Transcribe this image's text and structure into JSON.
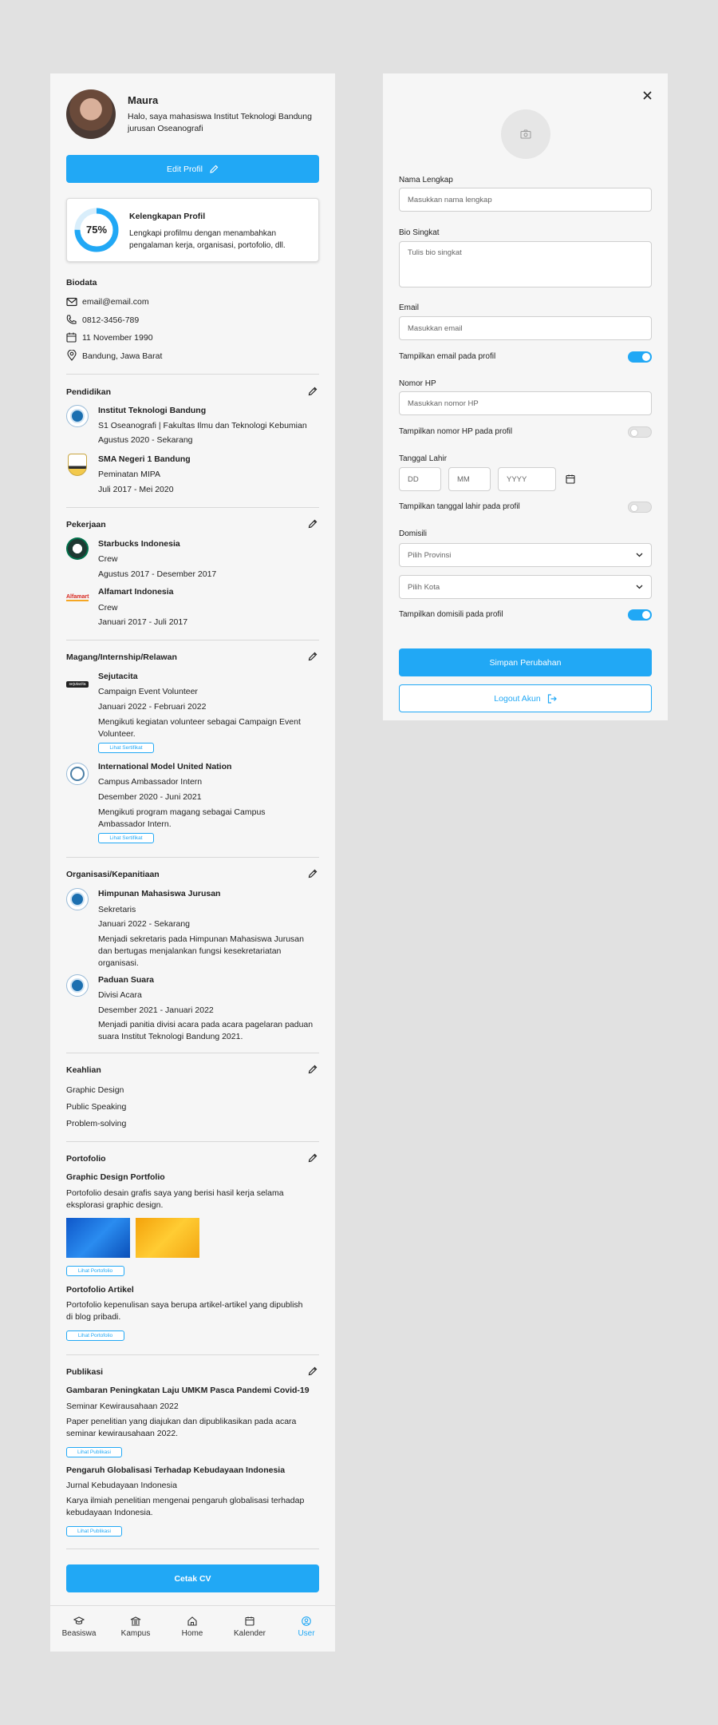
{
  "profile": {
    "name": "Maura",
    "bio": "Halo, saya mahasiswa Institut Teknologi Bandung jurusan Oseanografi",
    "edit_label": "Edit Profil"
  },
  "completeness": {
    "percent_label": "75%",
    "percent": 75,
    "title": "Kelengkapan Profil",
    "desc": "Lengkapi profilmu dengan menambahkan pengalaman kerja, organisasi, portofolio, dll."
  },
  "biodata": {
    "title": "Biodata",
    "email": "email@email.com",
    "phone": "0812-3456-789",
    "birth": "11 November 1990",
    "location": "Bandung, Jawa Barat"
  },
  "pendidikan": {
    "title": "Pendidikan",
    "items": [
      {
        "name": "Institut Teknologi Bandung",
        "detail": "S1 Oseanografi | Fakultas Ilmu dan Teknologi Kebumian",
        "period": "Agustus 2020 - Sekarang"
      },
      {
        "name": "SMA Negeri  1 Bandung",
        "detail": "Peminatan MIPA",
        "period": "Juli 2017 - Mei 2020"
      }
    ]
  },
  "pekerjaan": {
    "title": "Pekerjaan",
    "items": [
      {
        "name": "Starbucks Indonesia",
        "role": "Crew",
        "period": "Agustus 2017 - Desember 2017"
      },
      {
        "name": "Alfamart Indonesia",
        "logo": "Alfamart",
        "role": "Crew",
        "period": "Januari 2017 - Juli 2017"
      }
    ]
  },
  "magang": {
    "title": "Magang/Internship/Relawan",
    "items": [
      {
        "name": "Sejutacita",
        "logo": "sejutacita",
        "role": "Campaign Event Volunteer",
        "period": "Januari 2022 - Februari 2022",
        "desc": "Mengikuti kegiatan volunteer sebagai Campaign Event Volunteer.",
        "button": "Lihat Sertifikat"
      },
      {
        "name": "International Model United Nation",
        "role": "Campus Ambassador Intern",
        "period": "Desember 2020 - Juni 2021",
        "desc": "Mengikuti program magang sebagai Campus Ambassador Intern.",
        "button": "Lihat Sertifikat"
      }
    ]
  },
  "organisasi": {
    "title": "Organisasi/Kepanitiaan",
    "items": [
      {
        "name": "Himpunan Mahasiswa Jurusan",
        "role": "Sekretaris",
        "period": "Januari 2022 - Sekarang",
        "desc": "Menjadi sekretaris pada Himpunan Mahasiswa Jurusan dan bertugas menjalankan fungsi kesekretariatan organisasi."
      },
      {
        "name": "Paduan Suara",
        "role": "Divisi Acara",
        "period": "Desember 2021 - Januari 2022",
        "desc": "Menjadi panitia divisi acara pada acara pagelaran paduan suara Institut Teknologi Bandung 2021."
      }
    ]
  },
  "keahlian": {
    "title": "Keahlian",
    "items": [
      "Graphic Design",
      "Public Speaking",
      "Problem-solving"
    ]
  },
  "portofolio": {
    "title": "Portofolio",
    "items": [
      {
        "name": "Graphic Design Portfolio",
        "desc": "Portofolio desain grafis saya yang berisi hasil kerja selama eksplorasi graphic design.",
        "button": "Lihat Portofolio"
      },
      {
        "name": "Portofolio Artikel",
        "desc": "Portofolio kepenulisan saya berupa artikel-artikel yang dipublish di blog pribadi.",
        "button": "Lihat Portofolio"
      }
    ]
  },
  "publikasi": {
    "title": "Publikasi",
    "items": [
      {
        "name": "Gambaran Peningkatan Laju UMKM Pasca Pandemi Covid-19",
        "venue": "Seminar Kewirausahaan 2022",
        "desc": "Paper penelitian yang diajukan dan dipublikasikan pada acara seminar kewirausahaan 2022.",
        "button": "Lihat Publikasi"
      },
      {
        "name": "Pengaruh Globalisasi Terhadap Kebudayaan Indonesia",
        "venue": "Jurnal Kebudayaan Indonesia",
        "desc": "Karya ilmiah penelitian mengenai pengaruh globalisasi terhadap kebudayaan Indonesia.",
        "button": "Lihat Publikasi"
      }
    ]
  },
  "cetak_label": "Cetak CV",
  "nav": {
    "items": [
      "Beasiswa",
      "Kampus",
      "Home",
      "Kalender",
      "User"
    ],
    "active": "User"
  },
  "form": {
    "nama_label": "Nama Lengkap",
    "nama_placeholder": "Masukkan nama lengkap",
    "bio_label": "Bio Singkat",
    "bio_placeholder": "Tulis bio singkat",
    "email_label": "Email",
    "email_placeholder": "Masukkan email",
    "email_toggle": "Tampilkan email pada profil",
    "hp_label": "Nomor HP",
    "hp_placeholder": "Masukkan nomor HP",
    "hp_toggle": "Tampilkan nomor HP pada profil",
    "tgl_label": "Tanggal Lahir",
    "dd": "DD",
    "mm": "MM",
    "yyyy": "YYYY",
    "tgl_toggle": "Tampilkan tanggal lahir pada profil",
    "domisili_label": "Domisili",
    "provinsi": "Pilih Provinsi",
    "kota": "Pilih Kota",
    "domisili_toggle": "Tampilkan domisili pada profil",
    "toggles": {
      "email": true,
      "hp": false,
      "tgl": false,
      "domisili": true
    },
    "save": "Simpan Perubahan",
    "logout": "Logout Akun"
  },
  "colors": {
    "accent": "#21a8f5",
    "panel": "#f6f6f6",
    "background": "#e1e1e1"
  }
}
